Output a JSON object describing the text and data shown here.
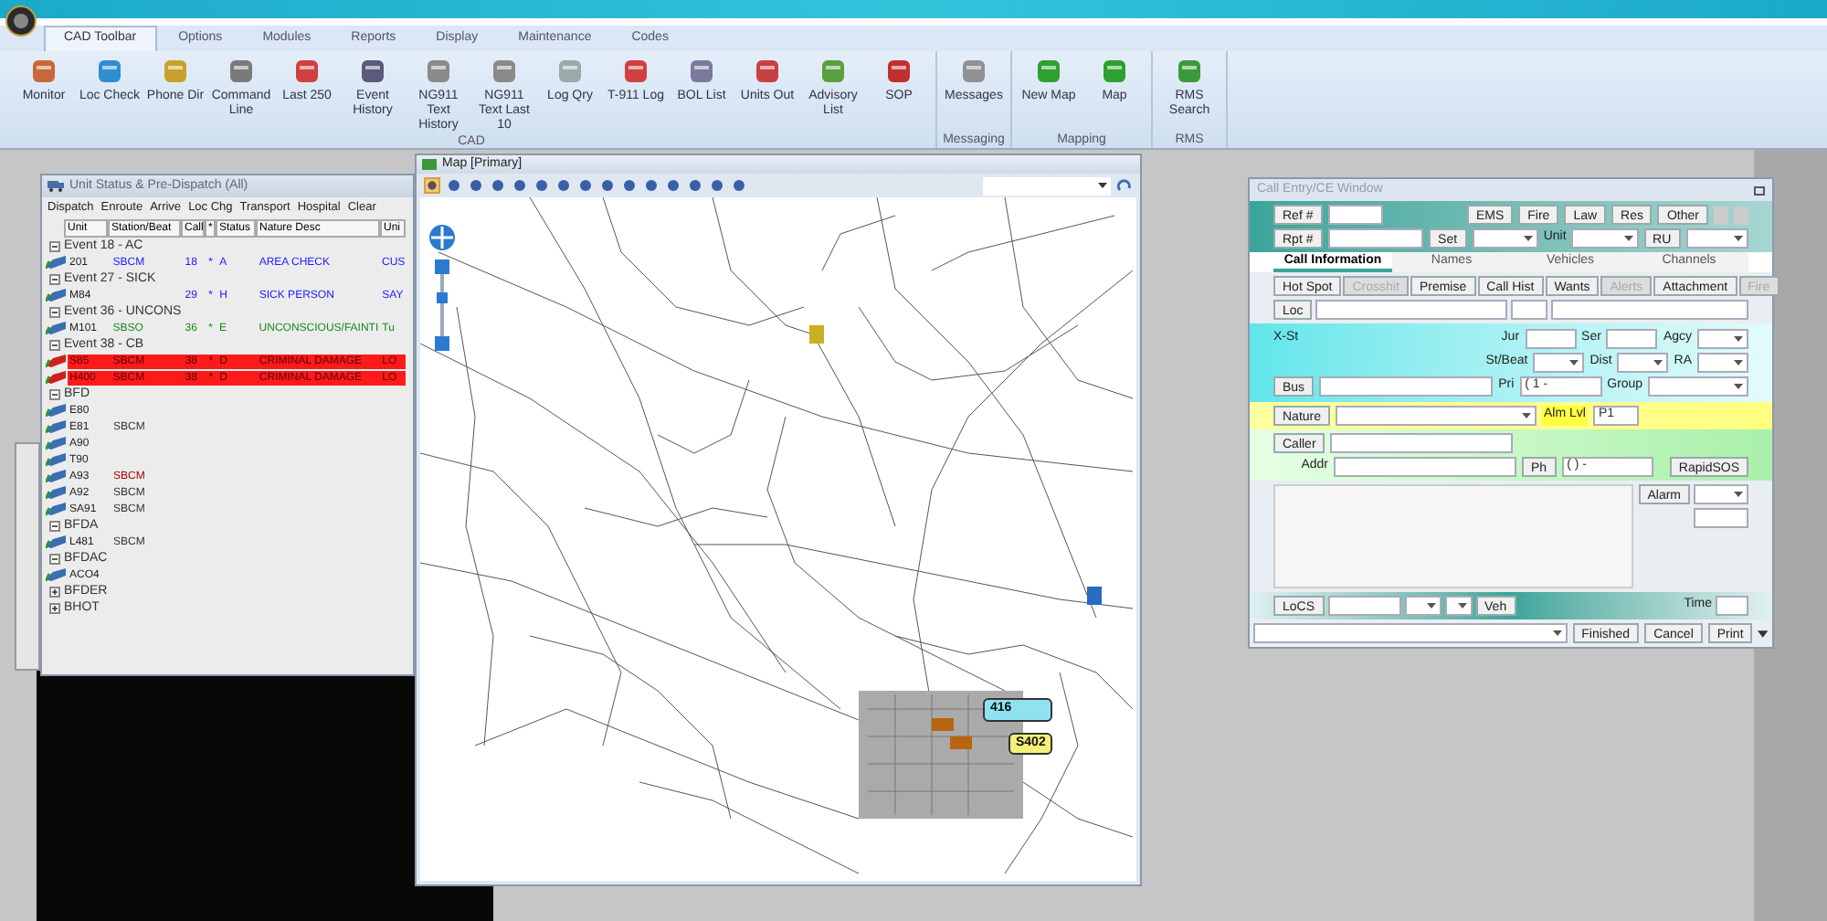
{
  "app": {
    "tabs": [
      {
        "label": "CAD Toolbar",
        "selected": true
      },
      {
        "label": "Options",
        "selected": false
      },
      {
        "label": "Modules",
        "selected": false
      },
      {
        "label": "Reports",
        "selected": false
      },
      {
        "label": "Display",
        "selected": false
      },
      {
        "label": "Maintenance",
        "selected": false
      },
      {
        "label": "Codes",
        "selected": false
      }
    ]
  },
  "ribbon": {
    "groups": [
      {
        "label": "CAD",
        "buttons": [
          {
            "label": "Monitor"
          },
          {
            "label": "Loc Check"
          },
          {
            "label": "Phone Dir"
          },
          {
            "label": "Command Line"
          },
          {
            "label": "Last 250"
          },
          {
            "label": "Event History"
          },
          {
            "label": "NG911 Text History"
          },
          {
            "label": "NG911 Text Last 10"
          },
          {
            "label": "Log Qry"
          },
          {
            "label": "T-911 Log"
          },
          {
            "label": "BOL List"
          },
          {
            "label": "Units Out"
          },
          {
            "label": "Advisory List"
          },
          {
            "label": "SOP"
          }
        ]
      },
      {
        "label": "Messaging",
        "buttons": [
          {
            "label": "Messages"
          }
        ]
      },
      {
        "label": "Mapping",
        "buttons": [
          {
            "label": "New Map"
          },
          {
            "label": "Map"
          }
        ]
      },
      {
        "label": "RMS",
        "buttons": [
          {
            "label": "RMS Search"
          }
        ]
      }
    ]
  },
  "unit_status": {
    "title": "Unit Status & Pre-Dispatch (All)",
    "menu": [
      "Dispatch",
      "Enroute",
      "Arrive",
      "Loc Chg",
      "Transport",
      "Hospital",
      "Clear"
    ],
    "columns": [
      "Unit",
      "Station/Beat",
      "Call",
      "*",
      "Status",
      "Nature Desc",
      "Uni"
    ],
    "rows": [
      {
        "kind": "group",
        "label": "Event 18 - AC",
        "expanded": true
      },
      {
        "kind": "unit",
        "alert": false,
        "color": "#1a1aff",
        "cells": [
          "201",
          "SBCM",
          "18",
          "*",
          "A",
          "AREA CHECK",
          "CUS"
        ]
      },
      {
        "kind": "group",
        "label": "Event 27 - SICK",
        "expanded": true
      },
      {
        "kind": "unit",
        "alert": false,
        "color": "#1a1aff",
        "cells": [
          "M84",
          "",
          "29",
          "*",
          "H",
          "SICK PERSON",
          "SAY"
        ]
      },
      {
        "kind": "group",
        "label": "Event 36 - UNCONS",
        "expanded": true
      },
      {
        "kind": "unit",
        "alert": false,
        "color": "#1a8a1a",
        "cells": [
          "M101",
          "SBSO",
          "36",
          "*",
          "E",
          "UNCONSCIOUS/FAINTI",
          "Tu"
        ]
      },
      {
        "kind": "group",
        "label": "Event 38 - CB",
        "expanded": true
      },
      {
        "kind": "unit",
        "alert": true,
        "cells": [
          "S85",
          "SBCM",
          "38",
          "*",
          "D",
          "CRIMINAL DAMAGE",
          "LO"
        ]
      },
      {
        "kind": "unit",
        "alert": true,
        "cells": [
          "H400",
          "SBCM",
          "38",
          "*",
          "D",
          "CRIMINAL DAMAGE",
          "LO"
        ]
      },
      {
        "kind": "group",
        "label": "BFD",
        "expanded": true
      },
      {
        "kind": "unit",
        "alert": false,
        "cells": [
          "E80"
        ]
      },
      {
        "kind": "unit",
        "alert": false,
        "color": "#333333",
        "cells": [
          "E81",
          "SBCM"
        ]
      },
      {
        "kind": "unit",
        "alert": false,
        "cells": [
          "A90"
        ]
      },
      {
        "kind": "unit",
        "alert": false,
        "cells": [
          "T90"
        ]
      },
      {
        "kind": "unit",
        "alert": false,
        "color": "#aa0000",
        "cells": [
          "A93",
          "SBCM"
        ]
      },
      {
        "kind": "unit",
        "alert": false,
        "color": "#333333",
        "cells": [
          "A92",
          "SBCM"
        ]
      },
      {
        "kind": "unit",
        "alert": false,
        "color": "#333333",
        "cells": [
          "SA91",
          "SBCM"
        ]
      },
      {
        "kind": "group",
        "label": "BFDA",
        "expanded": true
      },
      {
        "kind": "unit",
        "alert": false,
        "color": "#333333",
        "cells": [
          "L481",
          "SBCM"
        ]
      },
      {
        "kind": "group",
        "label": "BFDAC",
        "expanded": true
      },
      {
        "kind": "unit",
        "alert": false,
        "cells": [
          "ACO4"
        ]
      },
      {
        "kind": "group",
        "label": "BFDER",
        "expanded": false
      },
      {
        "kind": "group",
        "label": "BHOT",
        "expanded": false
      }
    ]
  },
  "map": {
    "title": "Map [Primary]",
    "units": [
      {
        "label": "416",
        "color": "#8fe3f0"
      },
      {
        "label": "S402",
        "color": "#f5f07a"
      }
    ]
  },
  "call_entry": {
    "title": "Call Entry/CE Window",
    "ref_label": "Ref #",
    "agency_buttons": [
      "EMS",
      "Fire",
      "Law",
      "Res",
      "Other"
    ],
    "rpt_label": "Rpt #",
    "set_label": "Set",
    "unit_label": "Unit",
    "ru_label": "RU",
    "tabs": [
      {
        "label": "Call Information",
        "selected": true
      },
      {
        "label": "Names",
        "selected": false
      },
      {
        "label": "Vehicles",
        "selected": false
      },
      {
        "label": "Channels",
        "selected": false
      }
    ],
    "actions": [
      {
        "label": "Hot Spot",
        "disabled": false
      },
      {
        "label": "Crosshit",
        "disabled": true
      },
      {
        "label": "Premise",
        "disabled": false
      },
      {
        "label": "Call Hist",
        "disabled": false
      },
      {
        "label": "Wants",
        "disabled": false
      },
      {
        "label": "Alerts",
        "disabled": true
      },
      {
        "label": "Attachment",
        "disabled": false
      },
      {
        "label": "Fire",
        "disabled": true
      }
    ],
    "loc_label": "Loc",
    "xst_label": "X-St",
    "jur_label": "Jur",
    "ser_label": "Ser",
    "agcy_label": "Agcy",
    "beat_label": "St/Beat",
    "dist_label": "Dist",
    "ra_label": "RA",
    "bus_label": "Bus",
    "pri_label": "Pri",
    "pri_value": "( 1 -",
    "group_label": "Group",
    "nature_label": "Nature",
    "alarm_level_label": "Alm Lvl",
    "p_value": "P1",
    "caller_label": "Caller",
    "addr_label": "Addr",
    "ph_label": "Ph",
    "ph_value": "(   )    -",
    "rapid_label": "RapidSOS",
    "alarm_label": "Alarm",
    "locs_label": "LoCS",
    "veh_label": "Veh",
    "time_label": "Time",
    "footer_buttons": [
      "Finished",
      "Cancel",
      "Print"
    ]
  }
}
